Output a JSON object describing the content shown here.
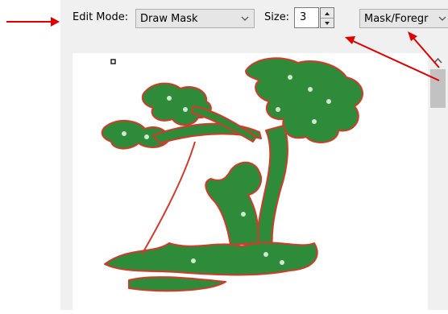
{
  "toolbar": {
    "edit_mode_label": "Edit Mode:",
    "edit_mode_value": "Draw Mask",
    "size_label": "Size:",
    "size_value": "3",
    "layer_value": "Mask/Foregr"
  },
  "icons": [
    "chevron-down-icon",
    "spin-up-icon",
    "spin-down-icon",
    "scroll-up-icon"
  ],
  "colors": {
    "panel": "#f0f0f0",
    "annotation_arrow": "#e00000",
    "mask_fill": "#2e8b3a",
    "mask_outline": "#d23a2a"
  }
}
